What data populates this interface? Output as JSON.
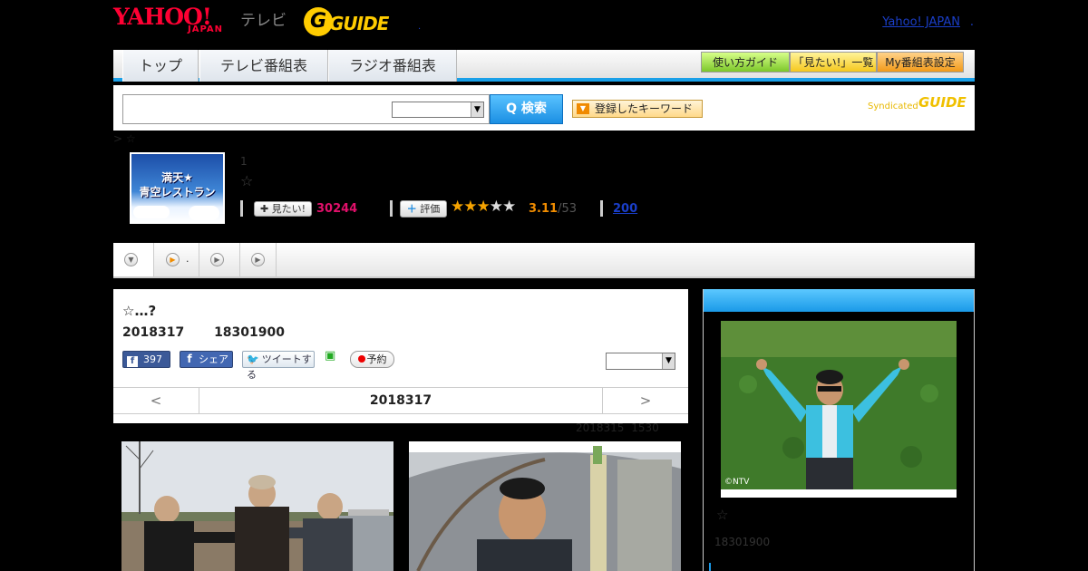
{
  "header": {
    "yahoo_logo": "YAHOO!",
    "yahoo_sub": "JAPAN",
    "tv_label": "テレビ",
    "gguide_logo": "GUIDE",
    "yahoo_japan_link": "Yahoo! JAPAN",
    "dot": "."
  },
  "nav": {
    "tabs": [
      "トップ",
      "テレビ番組表",
      "ラジオ番組表"
    ],
    "buttons": [
      "使い方ガイド",
      "「見たい!」一覧",
      "My番組表設定"
    ]
  },
  "search": {
    "input_value": "",
    "select_value": "",
    "search_button": "Q 検索",
    "keyword_button": "登録したキーワード",
    "syndicated": "Syndicated",
    "syndicated_logo": "GUIDE"
  },
  "breadcrumb": "> ☆",
  "program": {
    "thumb_title_line1": "満天★",
    "thumb_title_line2": "青空レストラン",
    "number": "1",
    "star": "☆",
    "mitai_button": "✚ 見たい!",
    "mitai_count": "30244",
    "hyoka_button": "評価",
    "rating_stars": 3,
    "rating_max": 5,
    "rating_value": "3.11",
    "rating_count": "/53",
    "review_count": "200"
  },
  "tabs": {
    "tab1_icon": "▼",
    "tab2_icon": "▶",
    "tab2_label": ".",
    "tab3_icon": "▶",
    "tab4_icon": "▶"
  },
  "episode": {
    "title": "☆…?",
    "date": "2018317 18301900",
    "fb_like_count": "397",
    "fb_share": "シェア",
    "tweet": "ツイートする",
    "reserve": "予約",
    "select_value": "",
    "nav_prev": "<",
    "nav_date": "2018317",
    "nav_next": ">",
    "updated": "2018315 1530"
  },
  "sidebar": {
    "photo_credit": "©NTV",
    "star": "☆",
    "time": "18301900"
  },
  "colors": {
    "accent_blue": "#1aa0e8",
    "pink": "#e0106a",
    "orange": "#f08c00",
    "link": "#1a3ec8"
  }
}
